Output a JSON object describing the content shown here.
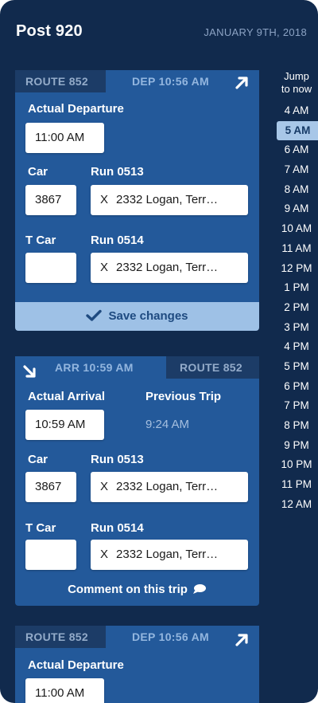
{
  "header": {
    "title": "Post 920",
    "date": "JANUARY 9TH, 2018"
  },
  "cards": [
    {
      "type": "departure",
      "route": "ROUTE 852",
      "timing": "DEP 10:56 AM",
      "time_label": "Actual Departure",
      "time_value": "11:00 AM",
      "car_label": "Car",
      "car_value": "3867",
      "run_label": "Run 0513",
      "run_value": "2332  Logan, Terr…",
      "tcar_label": "T Car",
      "tcar_value": "",
      "trun_label": "Run 0514",
      "trun_value": "2332  Logan, Terr…",
      "remove_glyph": "X",
      "save_label": "Save changes"
    },
    {
      "type": "arrival",
      "route": "ROUTE 852",
      "timing": "ARR 10:59 AM",
      "time_label": "Actual Arrival",
      "time_value": "10:59 AM",
      "previous_label": "Previous Trip",
      "previous_value": "9:24 AM",
      "car_label": "Car",
      "car_value": "3867",
      "run_label": "Run 0513",
      "run_value": "2332  Logan, Terr…",
      "tcar_label": "T Car",
      "tcar_value": "",
      "trun_label": "Run 0514",
      "trun_value": "2332  Logan, Terr…",
      "remove_glyph": "X",
      "comment_label": "Comment on this trip"
    },
    {
      "type": "departure",
      "route": "ROUTE 852",
      "timing": "DEP 10:56 AM",
      "time_label": "Actual Departure",
      "time_value": "11:00 AM"
    }
  ],
  "jump": {
    "line1": "Jump",
    "line2": "to now",
    "times": [
      "4 AM",
      "5 AM",
      "6 AM",
      "7 AM",
      "8 AM",
      "9 AM",
      "10 AM",
      "11 AM",
      "12 PM",
      "1 PM",
      "2 PM",
      "3 PM",
      "4 PM",
      "5 PM",
      "6 PM",
      "7 PM",
      "8 PM",
      "9 PM",
      "10 PM",
      "11 PM",
      "12 AM"
    ],
    "active": "5 AM"
  },
  "icons": {
    "departure": "arrow-up-right-icon",
    "arrival": "arrow-down-right-icon",
    "save": "checkmark-icon",
    "comment": "speech-bubble-icon"
  },
  "colors": {
    "background": "#112a4d",
    "card": "#23599a",
    "tab_dark": "#1c3c67",
    "save_button": "#9ec1e6",
    "active_time": "#a8c7e8"
  }
}
